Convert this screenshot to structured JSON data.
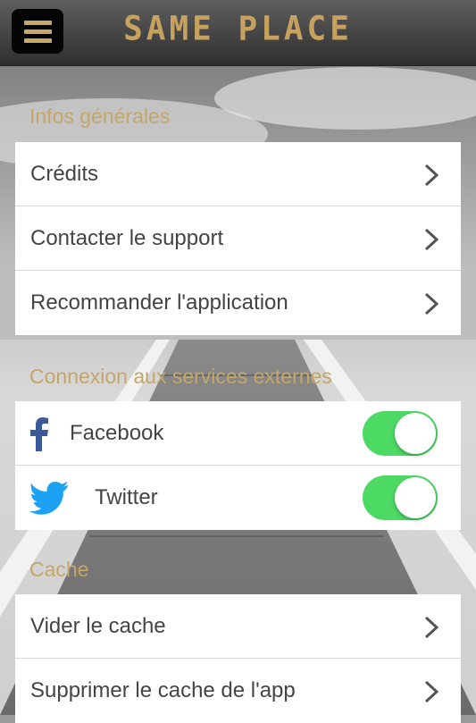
{
  "header": {
    "logo": "SAME PLACE",
    "menu_icon": "hamburger-icon"
  },
  "sections": {
    "general": {
      "title": "Infos générales",
      "items": [
        {
          "label": "Crédits"
        },
        {
          "label": "Contacter le support"
        },
        {
          "label": "Recommander l'application"
        }
      ]
    },
    "external": {
      "title": "Connexion aux services externes",
      "items": [
        {
          "label": "Facebook",
          "icon": "facebook-icon",
          "enabled": true
        },
        {
          "label": "Twitter",
          "icon": "twitter-icon",
          "enabled": true
        }
      ]
    },
    "cache": {
      "title": "Cache",
      "items": [
        {
          "label": "Vider le cache"
        },
        {
          "label": "Supprimer le cache de l'app"
        }
      ]
    }
  },
  "colors": {
    "accent_gold": "#c4a768",
    "toggle_on": "#4cd964",
    "facebook": "#3b5998",
    "twitter": "#1da1f2"
  }
}
